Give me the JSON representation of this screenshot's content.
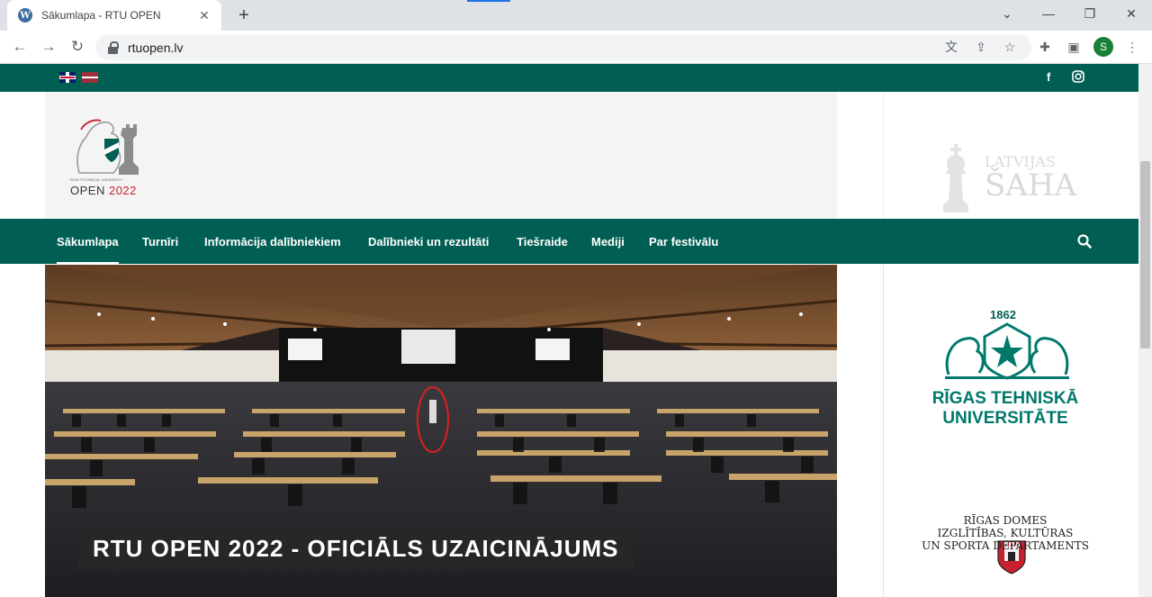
{
  "browser": {
    "tab_title": "Sākumlapa - RTU OPEN",
    "url": "rtuopen.lv",
    "profile_initial": "S",
    "icons": [
      "wordpress-favicon",
      "close-icon",
      "new-tab-icon",
      "back-icon",
      "forward-icon",
      "reload-icon",
      "lock-icon",
      "translate-icon",
      "share-icon",
      "bookmark-star-icon",
      "extensions-icon",
      "reading-list-icon",
      "menu-dots-icon"
    ]
  },
  "colors": {
    "brand_green": "#005f52",
    "accent_red": "#c8202f"
  },
  "header": {
    "logo_small_text": "RIGA TECHNICAL UNIVERSITY",
    "logo_word": "OPEN",
    "logo_year": "2022",
    "sponsor_line1": "LATVIJAS",
    "sponsor_line2": "ŠAHA"
  },
  "nav": {
    "items": [
      {
        "label": "Sākumlapa",
        "active": true
      },
      {
        "label": "Turnīri"
      },
      {
        "label": "Informācija dalībniekiem"
      },
      {
        "label": "Dalībnieki un rezultāti"
      },
      {
        "label": "Tiešraide"
      },
      {
        "label": "Mediji"
      },
      {
        "label": "Par festivālu"
      }
    ]
  },
  "hero": {
    "caption": "RTU OPEN 2022 - OFICIĀLS UZAICINĀJUMS"
  },
  "sidebar": {
    "rtu_year": "1862",
    "rtu_line1": "RĪGAS TEHNISKĀ",
    "rtu_line2": "UNIVERSITĀTE",
    "rd_line1": "RĪGAS DOMES",
    "rd_line2": "IZGLĪTĪBAS, KULTŪRAS",
    "rd_line3": "UN SPORTA DEPARTAMENTS"
  }
}
